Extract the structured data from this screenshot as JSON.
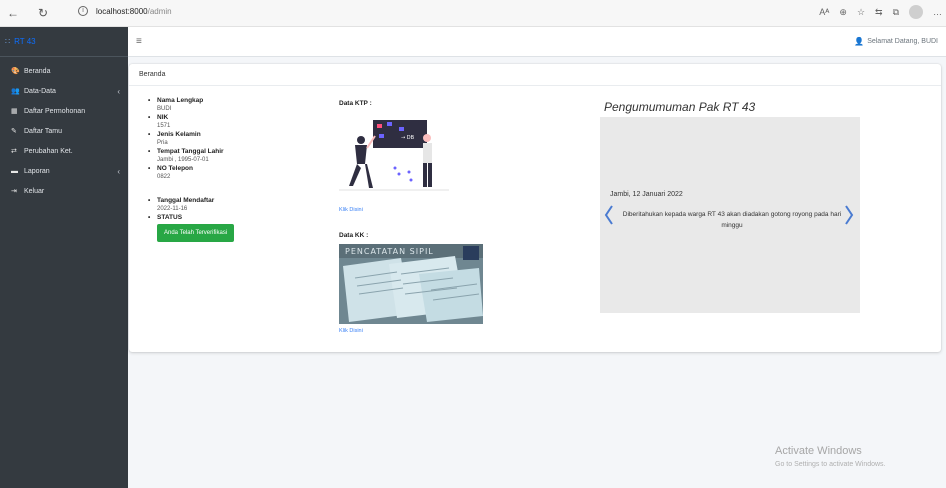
{
  "browser": {
    "url_host": "localhost:8000",
    "url_path": "/admin",
    "back_icon": "←",
    "reload_icon": "↻",
    "info_icon": "i",
    "right_icons": [
      "Aᴬ",
      "⊕",
      "☆",
      "⇆",
      "⧉",
      "…"
    ]
  },
  "sidebar": {
    "brand": "RT 43",
    "items": [
      {
        "label": "Beranda",
        "icon": "🎨",
        "has_arrow": false
      },
      {
        "label": "Data-Data",
        "icon": "👥",
        "has_arrow": true
      },
      {
        "label": "Daftar Permohonan",
        "icon": "▦",
        "has_arrow": false
      },
      {
        "label": "Daftar Tamu",
        "icon": "✎",
        "has_arrow": false
      },
      {
        "label": "Perubahan Ket.",
        "icon": "⇄",
        "has_arrow": false
      },
      {
        "label": "Laporan",
        "icon": "▬",
        "has_arrow": true
      },
      {
        "label": "Keluar",
        "icon": "⇥",
        "has_arrow": false
      }
    ]
  },
  "topbar": {
    "menu_icon": "≡",
    "welcome": "Selamat Datang, BUDI"
  },
  "card": {
    "header": "Beranda",
    "profile": [
      {
        "label": "Nama Lengkap",
        "value": "BUDI"
      },
      {
        "label": "NIK",
        "value": "1571"
      },
      {
        "label": "Jenis Kelamin",
        "value": "Pria"
      },
      {
        "label": "Tempat Tanggal Lahir",
        "value": "Jambi , 1995-07-01"
      },
      {
        "label": "NO Telepon",
        "value": "0822"
      }
    ],
    "registration": {
      "label": "Tanggal Mendaftar",
      "value": "2022-11-16"
    },
    "status": {
      "label": "STATUS",
      "button": "Anda Telah Terverifikasi"
    },
    "ktp": {
      "title": "Data KTP :",
      "link": "Klik Disini"
    },
    "kk": {
      "title": "Data KK :",
      "link": "Klik Disini",
      "image_text": "PENCATATAN SIPIL"
    },
    "announcement": {
      "title": "Pengumumuman Pak RT 43",
      "date": "Jambi, 12 Januari 2022",
      "text": "Diberitahukan kepada warga RT 43 akan diadakan gotong royong pada hari minggu"
    }
  },
  "windows": {
    "line1": "Activate Windows",
    "line2": "Go to Settings to activate Windows."
  },
  "colors": {
    "sidebar": "#343a40",
    "success": "#28a745",
    "link": "#3b82f6"
  }
}
